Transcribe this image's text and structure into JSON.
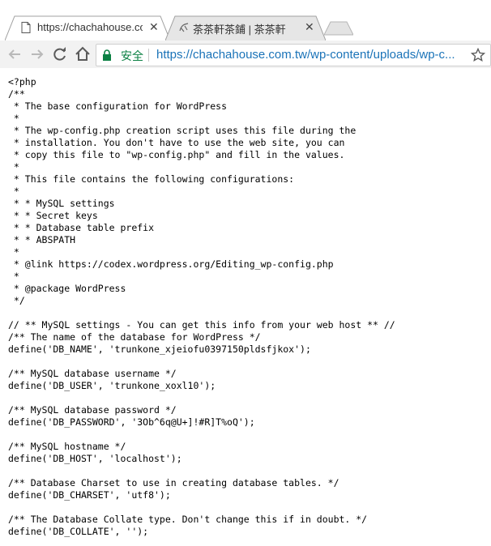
{
  "tabs": [
    {
      "title": "https://chachahouse.co",
      "close": "✕",
      "active": true
    },
    {
      "title": "茶茶軒茶鋪 | 茶茶軒",
      "close": "✕",
      "active": false
    }
  ],
  "toolbar": {
    "secure_label": "安全",
    "url_scheme": "https://",
    "url_host": "chachahouse.com.tw",
    "url_path": "/wp-content/uploads/wp-c..."
  },
  "colors": {
    "secure": "#0b8043",
    "url": "#1a73b8"
  },
  "icons": [
    "page-icon",
    "tea-favicon",
    "back-arrow-icon",
    "forward-arrow-icon",
    "reload-icon",
    "home-icon",
    "lock-icon",
    "star-icon"
  ],
  "file_lines": [
    "<?php",
    "/**",
    " * The base configuration for WordPress",
    " *",
    " * The wp-config.php creation script uses this file during the",
    " * installation. You don't have to use the web site, you can",
    " * copy this file to \"wp-config.php\" and fill in the values.",
    " *",
    " * This file contains the following configurations:",
    " *",
    " * * MySQL settings",
    " * * Secret keys",
    " * * Database table prefix",
    " * * ABSPATH",
    " *",
    " * @link https://codex.wordpress.org/Editing_wp-config.php",
    " *",
    " * @package WordPress",
    " */",
    "",
    "// ** MySQL settings - You can get this info from your web host ** //",
    "/** The name of the database for WordPress */",
    "define('DB_NAME', 'trunkone_xjeiofu0397150pldsfjkox');",
    "",
    "/** MySQL database username */",
    "define('DB_USER', 'trunkone_xoxl10');",
    "",
    "/** MySQL database password */",
    "define('DB_PASSWORD', '3Ob^6q@U+]!#R]T%oQ');",
    "",
    "/** MySQL hostname */",
    "define('DB_HOST', 'localhost');",
    "",
    "/** Database Charset to use in creating database tables. */",
    "define('DB_CHARSET', 'utf8');",
    "",
    "/** The Database Collate type. Don't change this if in doubt. */",
    "define('DB_COLLATE', '');"
  ]
}
